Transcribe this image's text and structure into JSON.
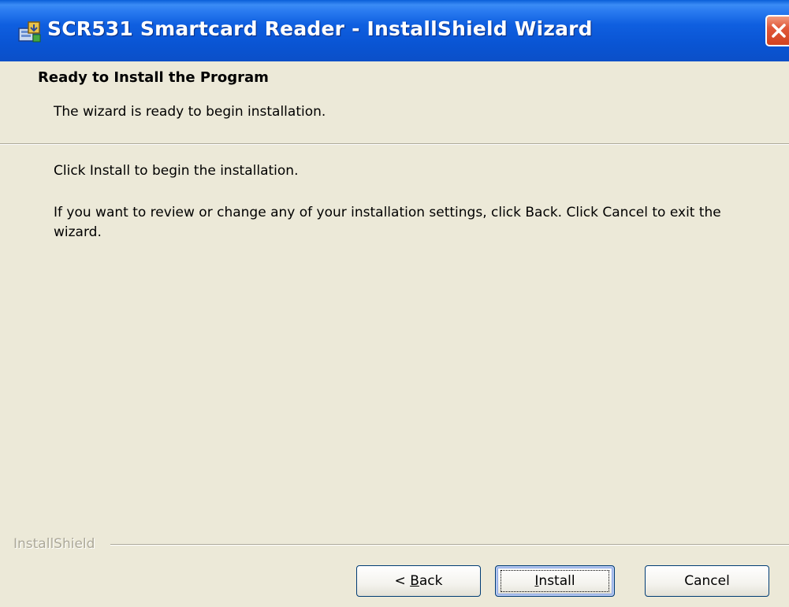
{
  "window": {
    "title": "SCR531 Smartcard Reader - InstallShield Wizard",
    "title_icon": "installer-icon",
    "close_icon": "close-icon",
    "title_bar_color": "#0a55d4",
    "close_button_color": "#e0583a"
  },
  "header": {
    "title": "Ready to Install the Program",
    "description": "The wizard is ready to begin installation."
  },
  "body": {
    "paragraph1": "Click Install to begin the installation.",
    "paragraph2": "If you want to review or change any of your installation settings, click Back. Click Cancel to exit the wizard."
  },
  "footer": {
    "brand": "InstallShield"
  },
  "buttons": {
    "back": {
      "prefix": "< ",
      "mnemonic": "B",
      "rest": "ack"
    },
    "install": {
      "mnemonic": "I",
      "rest": "nstall"
    },
    "cancel": "Cancel"
  }
}
